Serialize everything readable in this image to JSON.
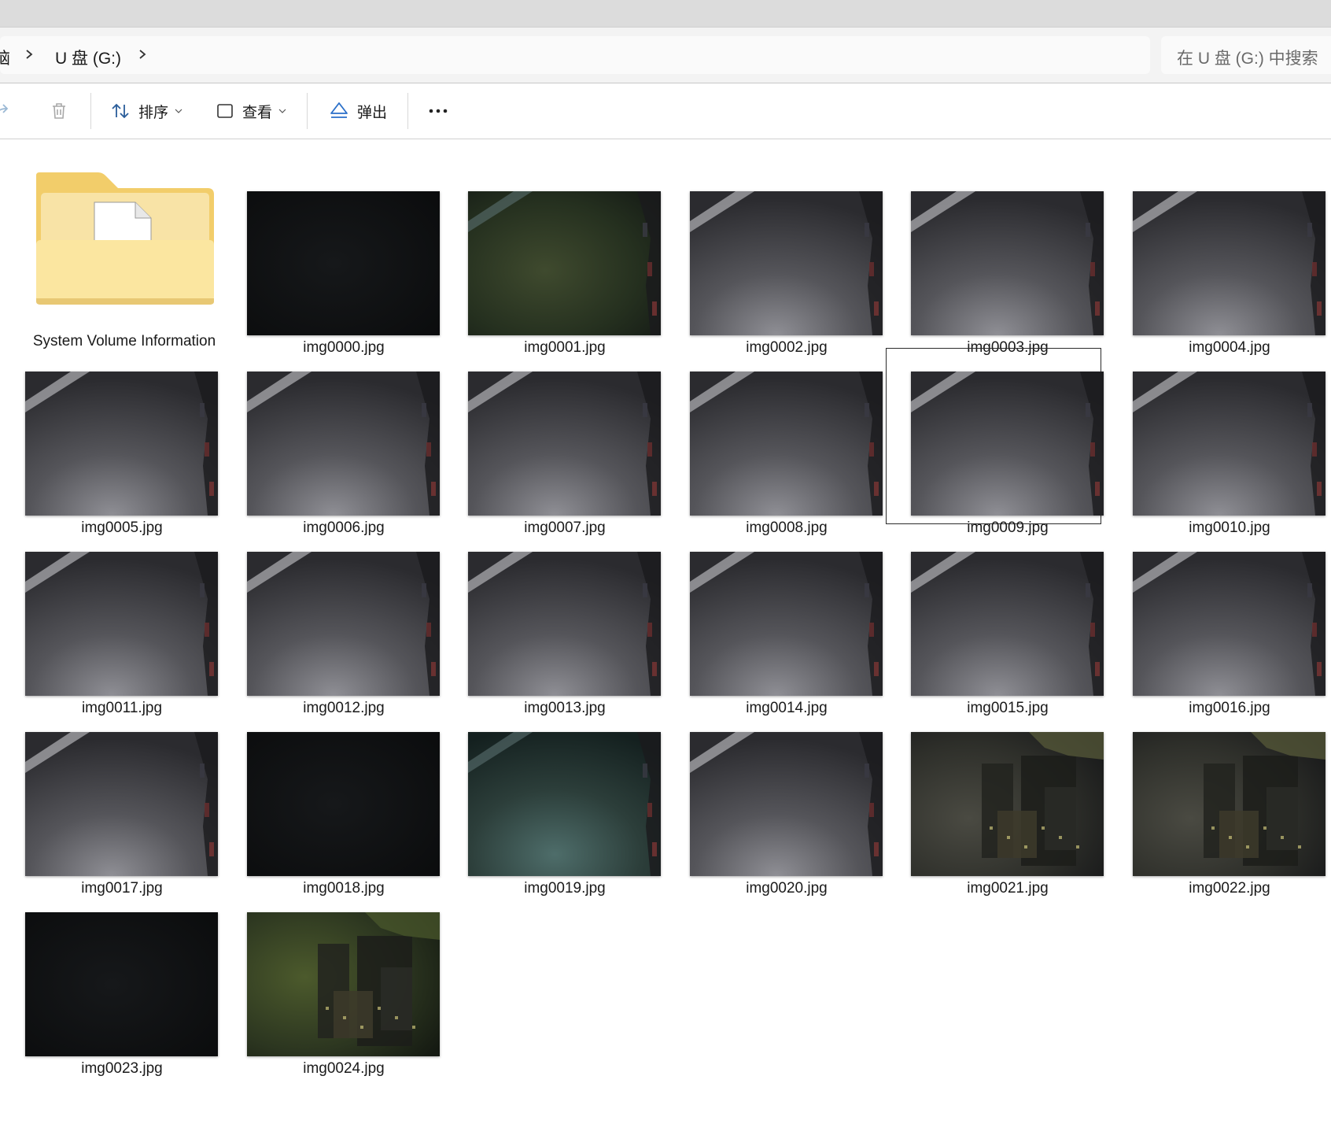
{
  "breadcrumb": {
    "cut_prefix": "脑",
    "drive": "U 盘 (G:)"
  },
  "search": {
    "placeholder": "在 U 盘 (G:) 中搜索"
  },
  "toolbar": {
    "sort_label": "排序",
    "view_label": "查看",
    "eject_label": "弹出"
  },
  "folder": {
    "name": "System Volume Information"
  },
  "files": [
    {
      "name": "img0000.jpg",
      "tone": "black"
    },
    {
      "name": "img0001.jpg",
      "tone": "green"
    },
    {
      "name": "img0002.jpg",
      "tone": "gray"
    },
    {
      "name": "img0003.jpg",
      "tone": "gray"
    },
    {
      "name": "img0004.jpg",
      "tone": "gray"
    },
    {
      "name": "img0005.jpg",
      "tone": "gray"
    },
    {
      "name": "img0006.jpg",
      "tone": "gray"
    },
    {
      "name": "img0007.jpg",
      "tone": "gray"
    },
    {
      "name": "img0008.jpg",
      "tone": "gray"
    },
    {
      "name": "img0009.jpg",
      "tone": "gray",
      "selected": true
    },
    {
      "name": "img0010.jpg",
      "tone": "gray"
    },
    {
      "name": "img0011.jpg",
      "tone": "gray"
    },
    {
      "name": "img0012.jpg",
      "tone": "gray"
    },
    {
      "name": "img0013.jpg",
      "tone": "gray"
    },
    {
      "name": "img0014.jpg",
      "tone": "gray"
    },
    {
      "name": "img0015.jpg",
      "tone": "gray"
    },
    {
      "name": "img0016.jpg",
      "tone": "gray"
    },
    {
      "name": "img0017.jpg",
      "tone": "gray"
    },
    {
      "name": "img0018.jpg",
      "tone": "black"
    },
    {
      "name": "img0019.jpg",
      "tone": "teal"
    },
    {
      "name": "img0020.jpg",
      "tone": "gray"
    },
    {
      "name": "img0021.jpg",
      "tone": "shelf"
    },
    {
      "name": "img0022.jpg",
      "tone": "shelf"
    },
    {
      "name": "img0023.jpg",
      "tone": "black"
    },
    {
      "name": "img0024.jpg",
      "tone": "greenshelf"
    }
  ]
}
